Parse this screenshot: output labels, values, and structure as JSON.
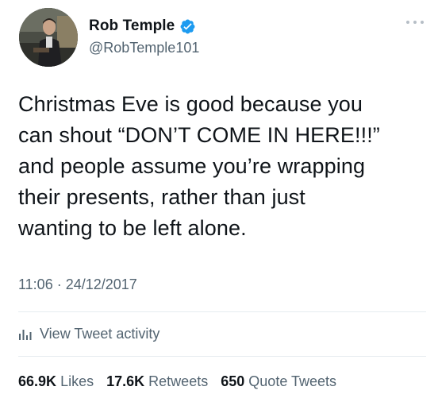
{
  "author": {
    "display_name": "Rob Temple",
    "handle": "@RobTemple101",
    "verified": true
  },
  "tweet": {
    "text": "Christmas Eve is good because you\ncan shout “DON’T COME IN HERE!!!”\nand people assume you’re wrapping\ntheir presents, rather than just\nwanting to be left alone.",
    "timestamp": "11:06 · 24/12/2017"
  },
  "activity": {
    "label": "View Tweet activity"
  },
  "stats": {
    "likes_count": "66.9K",
    "likes_label": "Likes",
    "retweets_count": "17.6K",
    "retweets_label": "Retweets",
    "quotes_count": "650",
    "quotes_label": "Quote Tweets"
  },
  "colors": {
    "verified_blue": "#1d9bf0",
    "secondary_text": "#536471",
    "primary_text": "#0f1419"
  }
}
